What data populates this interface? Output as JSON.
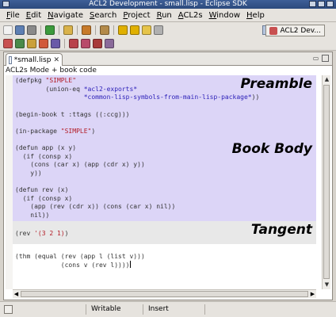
{
  "window": {
    "title": "ACL2 Development - small.lisp - Eclipse SDK"
  },
  "menu": [
    {
      "mnemonic": "F",
      "rest": "ile"
    },
    {
      "mnemonic": "E",
      "rest": "dit"
    },
    {
      "mnemonic": "N",
      "rest": "avigate"
    },
    {
      "mnemonic": "S",
      "rest": "earch"
    },
    {
      "mnemonic": "P",
      "rest": "roject"
    },
    {
      "mnemonic": "R",
      "rest": "un"
    },
    {
      "mnemonic": "A",
      "rest": "CL2s"
    },
    {
      "mnemonic": "W",
      "rest": "indow"
    },
    {
      "mnemonic": "H",
      "rest": "elp"
    }
  ],
  "perspective": {
    "label": "ACL2 Dev...",
    "icon": "acl2-perspective-icon"
  },
  "editor": {
    "tab_label": "*small.lisp",
    "mode_line": "ACL2s Mode + book code",
    "regions": {
      "preamble": {
        "label": "Preamble",
        "lines": [
          [
            [
              "c-p",
              "(defpkg "
            ],
            [
              "c-str",
              "\"SIMPLE\""
            ]
          ],
          [
            [
              "c-p",
              "        (union-eq "
            ],
            [
              "c-kw",
              "*acl2-exports*"
            ]
          ],
          [
            [
              "c-kw",
              "                  *common-lisp-symbols-from-main-lisp-package*"
            ],
            [
              "c-p",
              "))"
            ]
          ]
        ]
      },
      "body": {
        "label": "Book Body",
        "lines": [
          [
            [
              "c-p",
              ""
            ]
          ],
          [
            [
              "c-p",
              "(begin-book t :ttags ((:ccg)))"
            ]
          ],
          [
            [
              "c-p",
              ""
            ]
          ],
          [
            [
              "c-p",
              "(in-package "
            ],
            [
              "c-str",
              "\"SIMPLE\""
            ],
            [
              "c-p",
              ")"
            ]
          ],
          [
            [
              "c-p",
              ""
            ]
          ],
          [
            [
              "c-p",
              "(defun app (x y)"
            ]
          ],
          [
            [
              "c-p",
              "  (if (consp x)"
            ]
          ],
          [
            [
              "c-p",
              "    (cons (car x) (app (cdr x) y))"
            ]
          ],
          [
            [
              "c-p",
              "    y))"
            ]
          ],
          [
            [
              "c-p",
              ""
            ]
          ],
          [
            [
              "c-p",
              "(defun rev (x)"
            ]
          ],
          [
            [
              "c-p",
              "  (if (consp x)"
            ]
          ],
          [
            [
              "c-p",
              "    (app (rev (cdr x)) (cons (car x) nil))"
            ]
          ],
          [
            [
              "c-p",
              "    nil))"
            ]
          ]
        ]
      },
      "tangent": {
        "label": "Tangent",
        "lines": [
          [
            [
              "c-p",
              ""
            ]
          ],
          [
            [
              "c-p",
              "(rev "
            ],
            [
              "c-str",
              "'(3 2 1)"
            ],
            [
              "c-p",
              ")"
            ]
          ]
        ]
      },
      "active": {
        "lines": [
          [
            [
              "c-p",
              ""
            ]
          ],
          [
            [
              "c-p",
              "(thm (equal (rev (app l (list v)))"
            ]
          ],
          [
            [
              "c-p",
              "            (cons v (rev l))))"
            ]
          ]
        ]
      }
    }
  },
  "status": {
    "writable": "Writable",
    "insert": "Insert"
  },
  "toolbar": {
    "row1": [
      "new-icon",
      "save-icon",
      "print-icon",
      "sep",
      "run-icon",
      "sep",
      "open-type-icon",
      "sep",
      "build-icon",
      "sep",
      "search-icon",
      "sep",
      "next-annotation-icon",
      "prev-annotation-icon",
      "back-icon",
      "forward-icon"
    ],
    "row2": [
      "acl2-icon",
      "acl2-run-icon",
      "acl2-step-icon",
      "acl2-interrupt-icon",
      "acl2-book-icon",
      "sep",
      "acl2-undo-icon",
      "acl2-redo-icon",
      "acl2-stop-icon",
      "acl2-clear-icon"
    ]
  },
  "icon_colors": {
    "new-icon": "#f2f2f2",
    "save-icon": "#5d7fb3",
    "print-icon": "#8a8a8a",
    "run-icon": "#3c9a3c",
    "open-type-icon": "#d9b24a",
    "build-icon": "#c77a2a",
    "search-icon": "#b38a4a",
    "next-annotation-icon": "#e0b000",
    "prev-annotation-icon": "#e0b000",
    "back-icon": "#e6c44a",
    "forward-icon": "#b0b0b0",
    "acl2-icon": "#c85050",
    "acl2-run-icon": "#4a8a4a",
    "acl2-step-icon": "#caa03a",
    "acl2-interrupt-icon": "#d15a3a",
    "acl2-book-icon": "#6a5aa8",
    "acl2-undo-icon": "#b8424a",
    "acl2-redo-icon": "#b84a6a",
    "acl2-stop-icon": "#a83a3a",
    "acl2-clear-icon": "#8a6a9a"
  }
}
